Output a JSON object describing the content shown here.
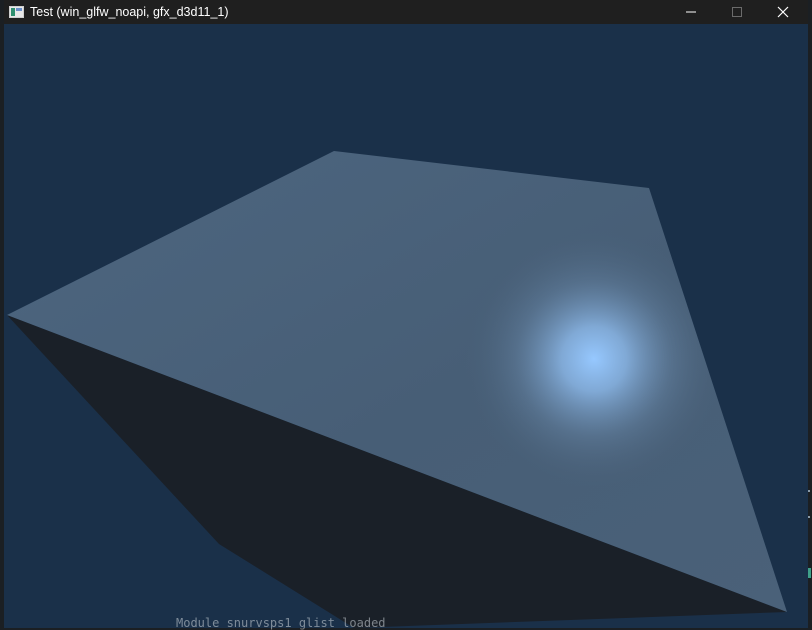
{
  "window": {
    "title": "Test (win_glfw_noapi, gfx_d3d11_1)"
  },
  "icons": {
    "app": "app-window-icon",
    "minimize": "minimize-icon",
    "maximize": "maximize-icon",
    "close": "close-icon"
  },
  "colors": {
    "background": "#1a3049",
    "titlebar": "#1f1f1f",
    "lit_face": "#4a6178",
    "shadow_face": "#1a2028",
    "specular": "#96c8ff"
  },
  "background_console": {
    "text": "Module snurvsps1 glist loaded"
  }
}
